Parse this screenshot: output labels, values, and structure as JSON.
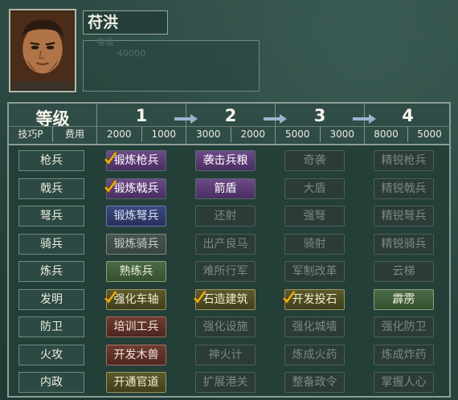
{
  "general": {
    "name": "苻洪",
    "faint_label": "等级",
    "faint_value": "40000",
    "portrait_icon": "general-portrait"
  },
  "table": {
    "header_title": "等级",
    "header_sub": [
      "技巧P",
      "费用"
    ],
    "levels": [
      {
        "title": "1",
        "skill": "2000",
        "cost": "1000"
      },
      {
        "title": "2",
        "skill": "3000",
        "cost": "2000"
      },
      {
        "title": "3",
        "skill": "5000",
        "cost": "3000"
      },
      {
        "title": "4",
        "skill": "8000",
        "cost": "5000"
      }
    ],
    "rows": [
      {
        "label": "枪兵",
        "cells": [
          {
            "text": "锻炼枪兵",
            "style": "purple",
            "learned": true
          },
          {
            "text": "袭击兵粮",
            "style": "purple",
            "learned": false
          },
          {
            "text": "奇袭",
            "style": "dim",
            "learned": false
          },
          {
            "text": "精锐枪兵",
            "style": "dim",
            "learned": false
          }
        ]
      },
      {
        "label": "戟兵",
        "cells": [
          {
            "text": "锻炼戟兵",
            "style": "purple",
            "learned": true
          },
          {
            "text": "箭盾",
            "style": "purple",
            "learned": false
          },
          {
            "text": "大盾",
            "style": "dim",
            "learned": false
          },
          {
            "text": "精锐戟兵",
            "style": "dim",
            "learned": false
          }
        ]
      },
      {
        "label": "弩兵",
        "cells": [
          {
            "text": "锻炼弩兵",
            "style": "indigo",
            "learned": false
          },
          {
            "text": "还射",
            "style": "dim",
            "learned": false
          },
          {
            "text": "强弩",
            "style": "dim",
            "learned": false
          },
          {
            "text": "精锐弩兵",
            "style": "dim",
            "learned": false
          }
        ]
      },
      {
        "label": "骑兵",
        "cells": [
          {
            "text": "锻炼骑兵",
            "style": "gray",
            "learned": false
          },
          {
            "text": "出产良马",
            "style": "dim",
            "learned": false
          },
          {
            "text": "骑射",
            "style": "dim",
            "learned": false
          },
          {
            "text": "精锐骑兵",
            "style": "dim",
            "learned": false
          }
        ]
      },
      {
        "label": "炼兵",
        "cells": [
          {
            "text": "熟练兵",
            "style": "green",
            "learned": false
          },
          {
            "text": "难所行军",
            "style": "dim",
            "learned": false
          },
          {
            "text": "军制改革",
            "style": "dim",
            "learned": false
          },
          {
            "text": "云梯",
            "style": "dim",
            "learned": false
          }
        ]
      },
      {
        "label": "发明",
        "cells": [
          {
            "text": "强化车轴",
            "style": "olive",
            "learned": true
          },
          {
            "text": "石造建筑",
            "style": "olive",
            "learned": true
          },
          {
            "text": "开发投石",
            "style": "olive",
            "learned": true
          },
          {
            "text": "霹雳",
            "style": "green",
            "learned": false
          }
        ]
      },
      {
        "label": "防卫",
        "cells": [
          {
            "text": "培训工兵",
            "style": "red",
            "learned": false
          },
          {
            "text": "强化设施",
            "style": "dim",
            "learned": false
          },
          {
            "text": "强化城墙",
            "style": "dim",
            "learned": false
          },
          {
            "text": "强化防卫",
            "style": "dim",
            "learned": false
          }
        ]
      },
      {
        "label": "火攻",
        "cells": [
          {
            "text": "开发木兽",
            "style": "red",
            "learned": false
          },
          {
            "text": "神火计",
            "style": "dim",
            "learned": false
          },
          {
            "text": "炼成火药",
            "style": "dim",
            "learned": false
          },
          {
            "text": "炼成炸药",
            "style": "dim",
            "learned": false
          }
        ]
      },
      {
        "label": "内政",
        "cells": [
          {
            "text": "开通官道",
            "style": "olive",
            "learned": false
          },
          {
            "text": "扩展港关",
            "style": "dim",
            "learned": false
          },
          {
            "text": "整备政令",
            "style": "dim",
            "learned": false
          },
          {
            "text": "掌握人心",
            "style": "dim",
            "learned": false
          }
        ]
      }
    ]
  },
  "icons": {
    "checkmark": "checkmark-icon",
    "arrow": "arrow-right-icon"
  },
  "colors": {
    "background": "#2b4741",
    "check": "#f2b51c",
    "arrow": "#9ab4d0"
  }
}
